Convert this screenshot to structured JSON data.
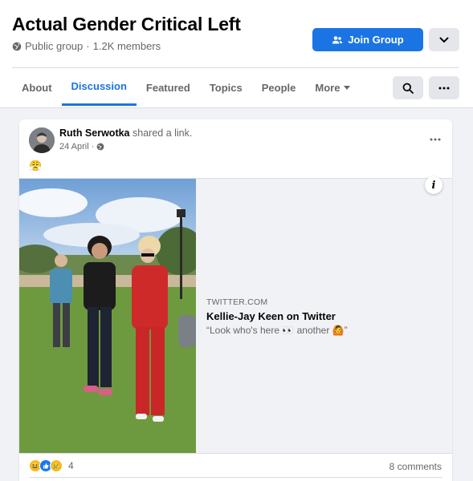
{
  "group": {
    "title": "Actual Gender Critical Left",
    "privacy": "Public group",
    "separator": "·",
    "members": "1.2K members",
    "join_label": "Join Group"
  },
  "tabs": [
    {
      "label": "About"
    },
    {
      "label": "Discussion"
    },
    {
      "label": "Featured"
    },
    {
      "label": "Topics"
    },
    {
      "label": "People"
    },
    {
      "label": "More"
    }
  ],
  "post": {
    "author": "Ruth Serwotka",
    "action": "shared a link.",
    "date": "24 April",
    "date_separator": "·",
    "emoji": "😤",
    "link": {
      "domain": "TWITTER.COM",
      "title": "Kellie-Jay Keen on Twitter",
      "description": "“Look who's here 👀 another 🙆”"
    },
    "reaction_count": "4",
    "comments": "8 comments"
  },
  "colors": {
    "accent": "#1b74e4",
    "secondary_text": "#65676b",
    "page_bg": "#f0f2f5"
  }
}
